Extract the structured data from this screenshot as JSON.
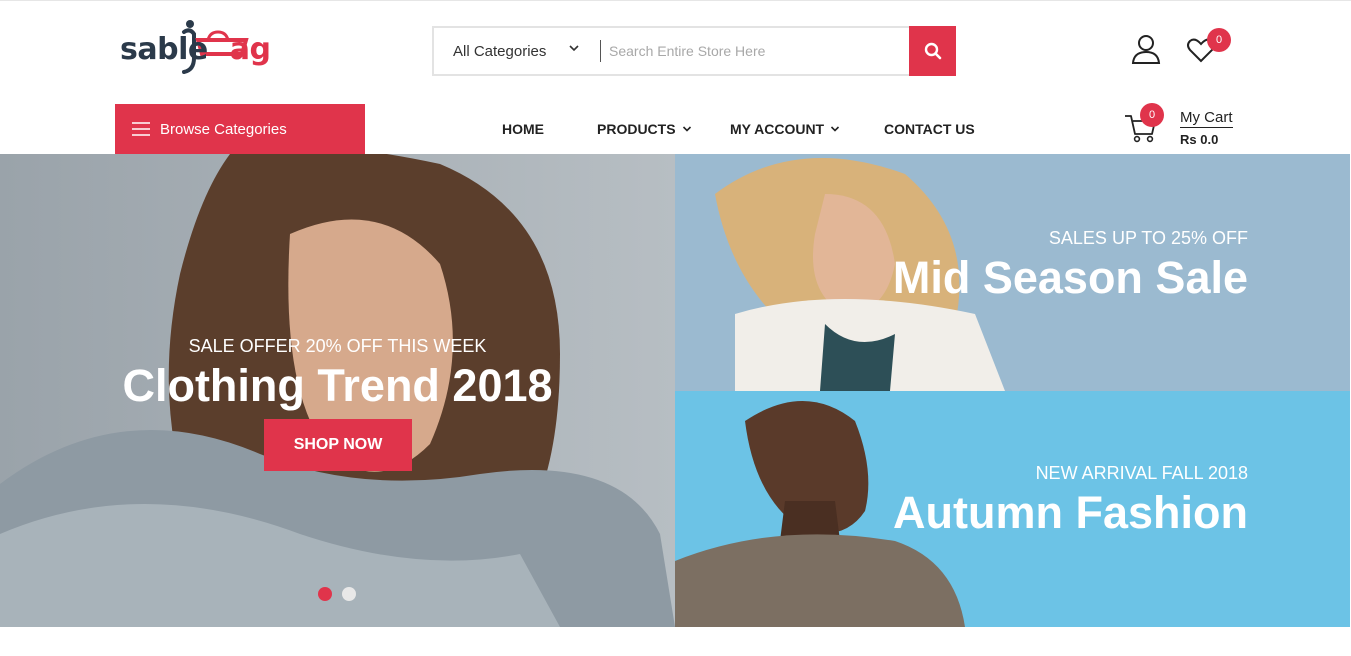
{
  "brand": {
    "logo_dark": "sable",
    "logo_red": "ag"
  },
  "search": {
    "category": "All Categories",
    "placeholder": "Search Entire Store Here"
  },
  "header": {
    "wishlist_count": "0"
  },
  "nav": {
    "browse_label": "Browse Categories",
    "items": [
      {
        "label": "HOME"
      },
      {
        "label": "PRODUCTS"
      },
      {
        "label": "MY ACCOUNT"
      },
      {
        "label": "CONTACT US"
      }
    ]
  },
  "cart": {
    "count": "0",
    "title": "My Cart",
    "total": "Rs 0.0"
  },
  "hero": {
    "subtitle": "SALE OFFER 20% OFF THIS WEEK",
    "title": "Clothing Trend 2018",
    "button": "SHOP NOW"
  },
  "promos": [
    {
      "subtitle": "SALES UP TO 25% OFF",
      "title": "Mid Season Sale"
    },
    {
      "subtitle": "NEW ARRIVAL FALL 2018",
      "title": "Autumn Fashion"
    }
  ],
  "colors": {
    "accent": "#e0344b",
    "dark": "#2b3a4a",
    "banner_sky": "#6cc3e6",
    "banner_steel": "#9bbad0"
  }
}
